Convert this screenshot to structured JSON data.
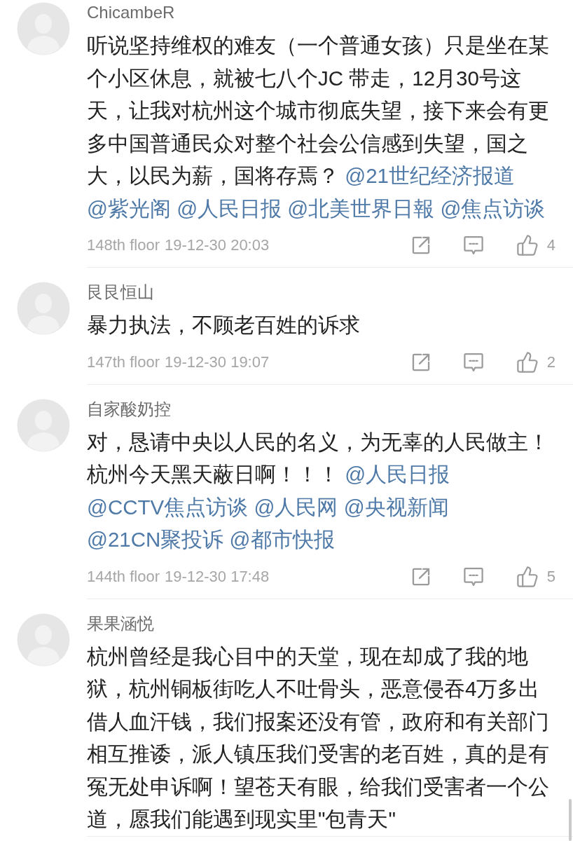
{
  "comments": [
    {
      "author": "ChicambeR",
      "text": "听说坚持维权的难友（一个普通女孩）只是坐在某个小区休息，就被七八个JC 带走，12月30号这天，让我对杭州这个城市彻底失望，接下来会有更多中国普通民众对整个社会公信感到失望，国之大，以民为薪，国将存焉？",
      "mentions": [
        "@21世纪经济报道",
        "@紫光阁",
        "@人民日报",
        "@北美世界日報",
        "@焦点访谈"
      ],
      "footer": {
        "floor": "148th floor",
        "time": "19-12-30 20:03",
        "likes": "4"
      }
    },
    {
      "author": "艮艮恒山",
      "text": "暴力执法，不顾老百姓的诉求",
      "footer": {
        "floor": "147th floor",
        "time": "19-12-30 19:07",
        "likes": "2"
      }
    },
    {
      "author": "自家酸奶控",
      "text": "对，恳请中央以人民的名义，为无辜的人民做主！杭州今天黑天蔽日啊！！！",
      "mentions": [
        "@人民日报",
        "@CCTV焦点访谈",
        "@人民网",
        "@央视新闻",
        "@21CN聚投诉",
        "@都市快报"
      ],
      "footer": {
        "floor": "144th floor",
        "time": "19-12-30 17:48",
        "likes": "5"
      }
    },
    {
      "author": "果果涵悦",
      "text": "杭州曾经是我心目中的天堂，现在却成了我的地狱，杭州铜板街吃人不吐骨头，恶意侵吞4万多出借人血汗钱，我们报案还没有管，政府和有关部门相互推诿，派人镇压我们受害的老百姓，真的是有冤无处申诉啊！望苍天有眼，给我们受害者一个公道，愿我们能遇到现实里\"包青天\""
    }
  ]
}
